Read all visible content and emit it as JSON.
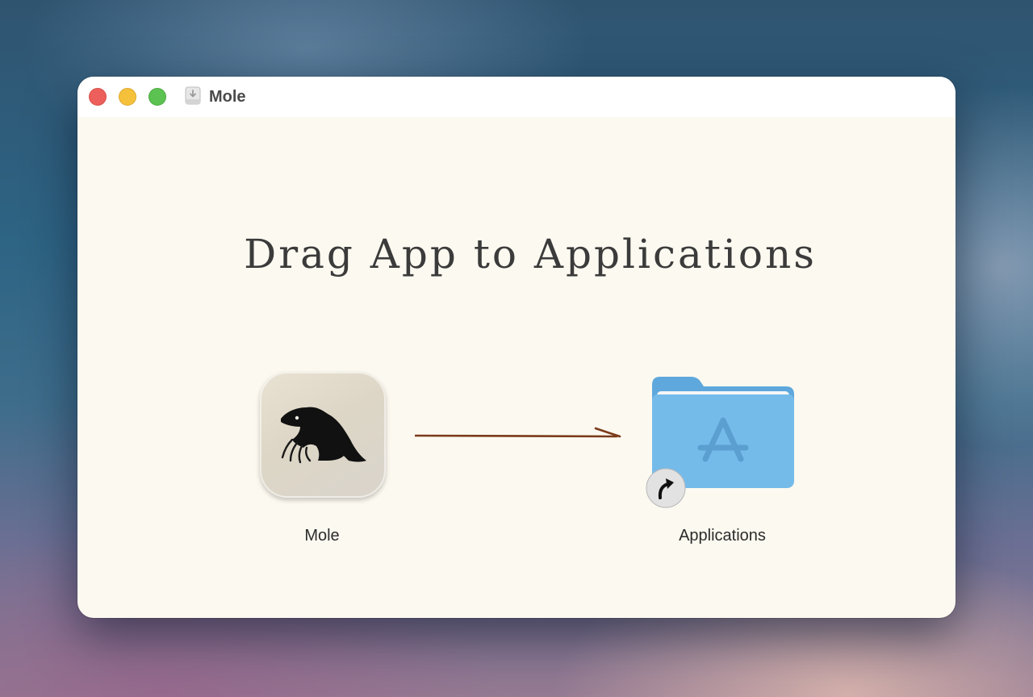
{
  "window": {
    "title": "Mole",
    "controls": [
      "close",
      "minimize",
      "zoom"
    ],
    "title_icon": "disk-image-icon"
  },
  "main": {
    "heading": "Drag App to Applications",
    "app": {
      "label": "Mole",
      "icon": "mole-app-icon"
    },
    "arrow": {
      "icon": "arrow-right-icon",
      "color": "#7a3a1a"
    },
    "folder": {
      "label": "Applications",
      "icon": "applications-folder-icon",
      "alias": "alias-arrow-icon"
    }
  },
  "colors": {
    "window_bg": "#fcf9f0",
    "folder_blue": "#6fb5e6",
    "close": "#ed5f5a",
    "minimize": "#f5c13b",
    "zoom": "#5cc251"
  }
}
